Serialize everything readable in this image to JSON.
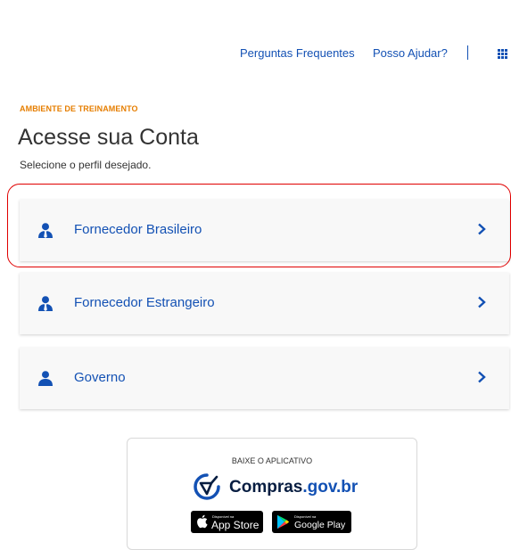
{
  "header": {
    "links": [
      "Perguntas Frequentes",
      "Posso Ajudar?"
    ],
    "separator": "|"
  },
  "main": {
    "environment_label": "AMBIENTE DE TREINAMENTO",
    "title": "Acesse sua Conta",
    "subtitle": "Selecione o perfil desejado.",
    "profiles": [
      {
        "label": "Fornecedor Brasileiro",
        "icon": "user-tie-icon",
        "highlighted": true
      },
      {
        "label": "Fornecedor Estrangeiro",
        "icon": "user-tie-icon",
        "highlighted": false
      },
      {
        "label": "Governo",
        "icon": "user-icon",
        "highlighted": false
      }
    ]
  },
  "app_download": {
    "caption": "BAIXE O APLICATIVO",
    "brand_name": "Compras",
    "brand_domain": ".gov.br",
    "app_store": {
      "small": "Disponível na",
      "big": "App Store"
    },
    "google_play": {
      "small": "Disponível na",
      "big": "Google Play"
    }
  },
  "colors": {
    "primary_blue": "#1351b4",
    "environment_orange": "#e67e00",
    "highlight_red": "#e00000",
    "card_background": "#f8f8f8"
  }
}
